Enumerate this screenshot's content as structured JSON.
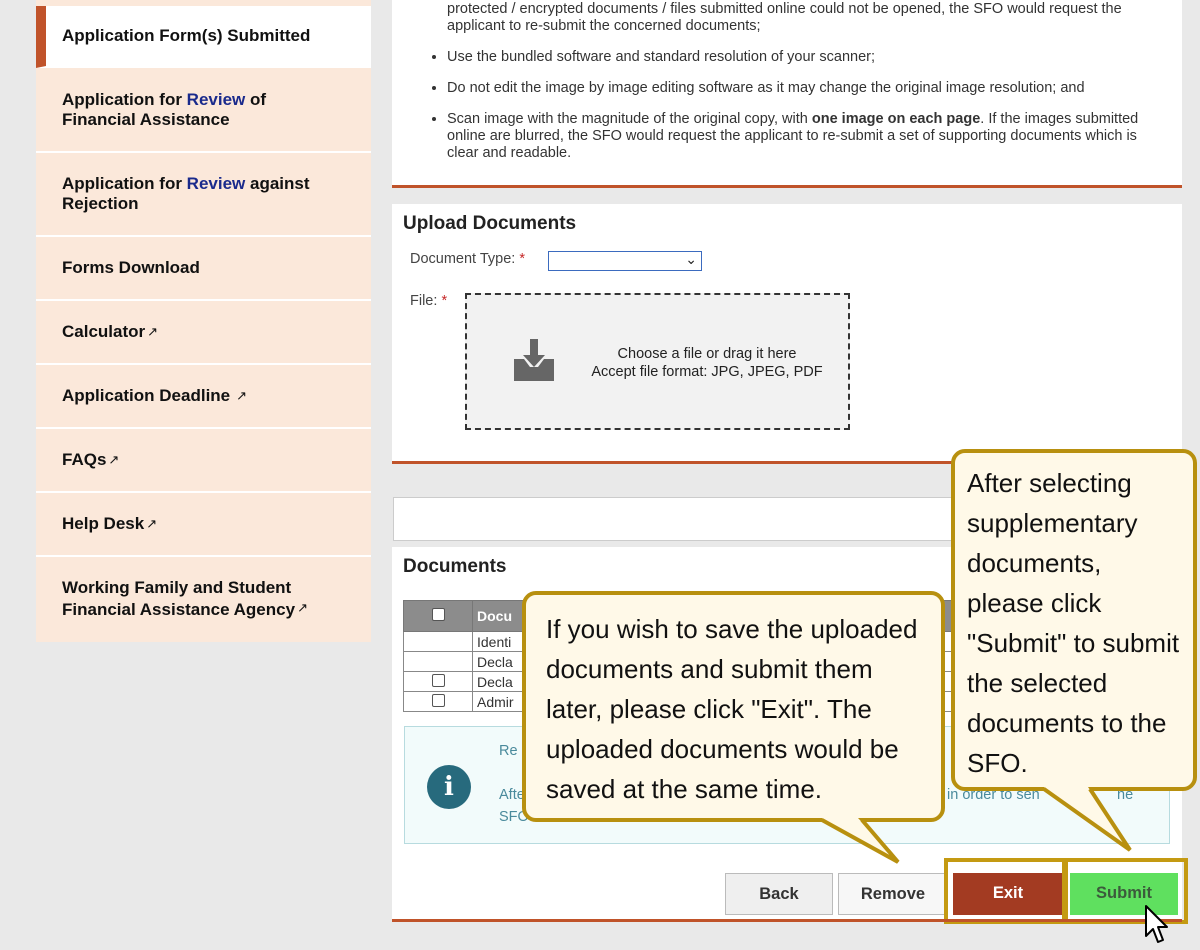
{
  "sidebar": {
    "items": [
      {
        "label": "Application Form(s) Submitted"
      },
      {
        "label_prefix": "Application for ",
        "label_highlight": "Review",
        "label_suffix": " of",
        "label_line2": "Financial Assistance"
      },
      {
        "label_prefix": "Application for ",
        "label_highlight": "Review",
        "label_suffix": " against",
        "label_line2": "Rejection"
      },
      {
        "label": "Forms Download"
      },
      {
        "label": "Calculator"
      },
      {
        "label": "Application Deadline"
      },
      {
        "label": "FAQs"
      },
      {
        "label": "Help Desk"
      },
      {
        "label": "Working Family and Student",
        "label_line2": "Financial Assistance Agency"
      }
    ],
    "external_link_icon": "external-link-icon"
  },
  "requirements": {
    "item0": "Do not upload any electronic documents / files with password protection or encryption. If the password protected / encrypted documents / files submitted online could not be opened, the SFO would request the applicant to re-submit the concerned documents;",
    "item1": "Use the bundled software and standard resolution of your scanner;",
    "item2": "Do not edit the image by image editing software as it may change the original image resolution; and",
    "item3_prefix": "Scan image with the magnitude of the original copy, with ",
    "item3_bold": "one image on each page",
    "item3_suffix": ". If the images submitted online are blurred, the SFO would request the applicant to re-submit a set of supporting documents which is clear and readable."
  },
  "upload": {
    "title": "Upload Documents",
    "doc_type_label": "Document Type:",
    "required_mark": "*",
    "file_label": "File:",
    "dropzone_line1": "Choose a file or drag it here",
    "dropzone_line2": "Accept file format: JPG, JPEG, PDF"
  },
  "documents": {
    "title": "Documents",
    "header": "Docu",
    "rows": [
      "Identi",
      "Decla",
      "Decla",
      "Admir"
    ]
  },
  "info": {
    "line1": "Re",
    "line2": "Afte",
    "line3": "SFO",
    "right_text": "in order to sen",
    "right_tail": "he"
  },
  "buttons": {
    "back": "Back",
    "remove": "Remove",
    "exit": "Exit",
    "submit": "Submit"
  },
  "callouts": {
    "exit": [
      "If you wish to save the uploaded",
      "documents and submit them",
      "later, please click \"Exit\". The",
      "uploaded documents would be",
      "saved at the same time."
    ],
    "submit": [
      "After selecting",
      "supplementary",
      "documents,",
      "please click",
      "\"Submit\" to submit",
      "the selected",
      "documents to the",
      "SFO."
    ]
  },
  "colors": {
    "accent": "#c0532a",
    "sidebar_bg": "#fbe8da",
    "exit_button": "#a33b22",
    "submit_button": "#5fe05f",
    "callout_border": "#b8900f"
  }
}
